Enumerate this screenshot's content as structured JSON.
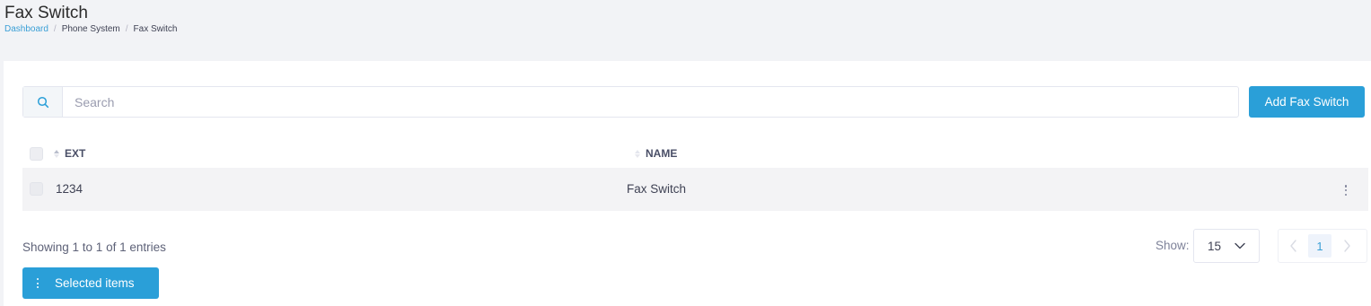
{
  "header": {
    "title": "Fax Switch",
    "breadcrumb": [
      "Dashboard",
      "Phone System",
      "Fax Switch"
    ]
  },
  "search": {
    "placeholder": "Search",
    "value": "",
    "icon": "search-icon"
  },
  "toolbar": {
    "add_label": "Add Fax Switch"
  },
  "table": {
    "columns": [
      "EXT",
      "NAME"
    ],
    "rows": [
      {
        "ext": "1234",
        "name": "Fax Switch"
      }
    ]
  },
  "footer": {
    "info": "Showing 1 to 1 of 1 entries",
    "show_label": "Show:",
    "page_size": "15",
    "current_page": "1",
    "selected_label": "Selected items"
  },
  "colors": {
    "primary": "#2a9fd8",
    "link": "#3a9fd6",
    "background": "#f2f3f6",
    "row_bg": "#f3f3f5"
  }
}
